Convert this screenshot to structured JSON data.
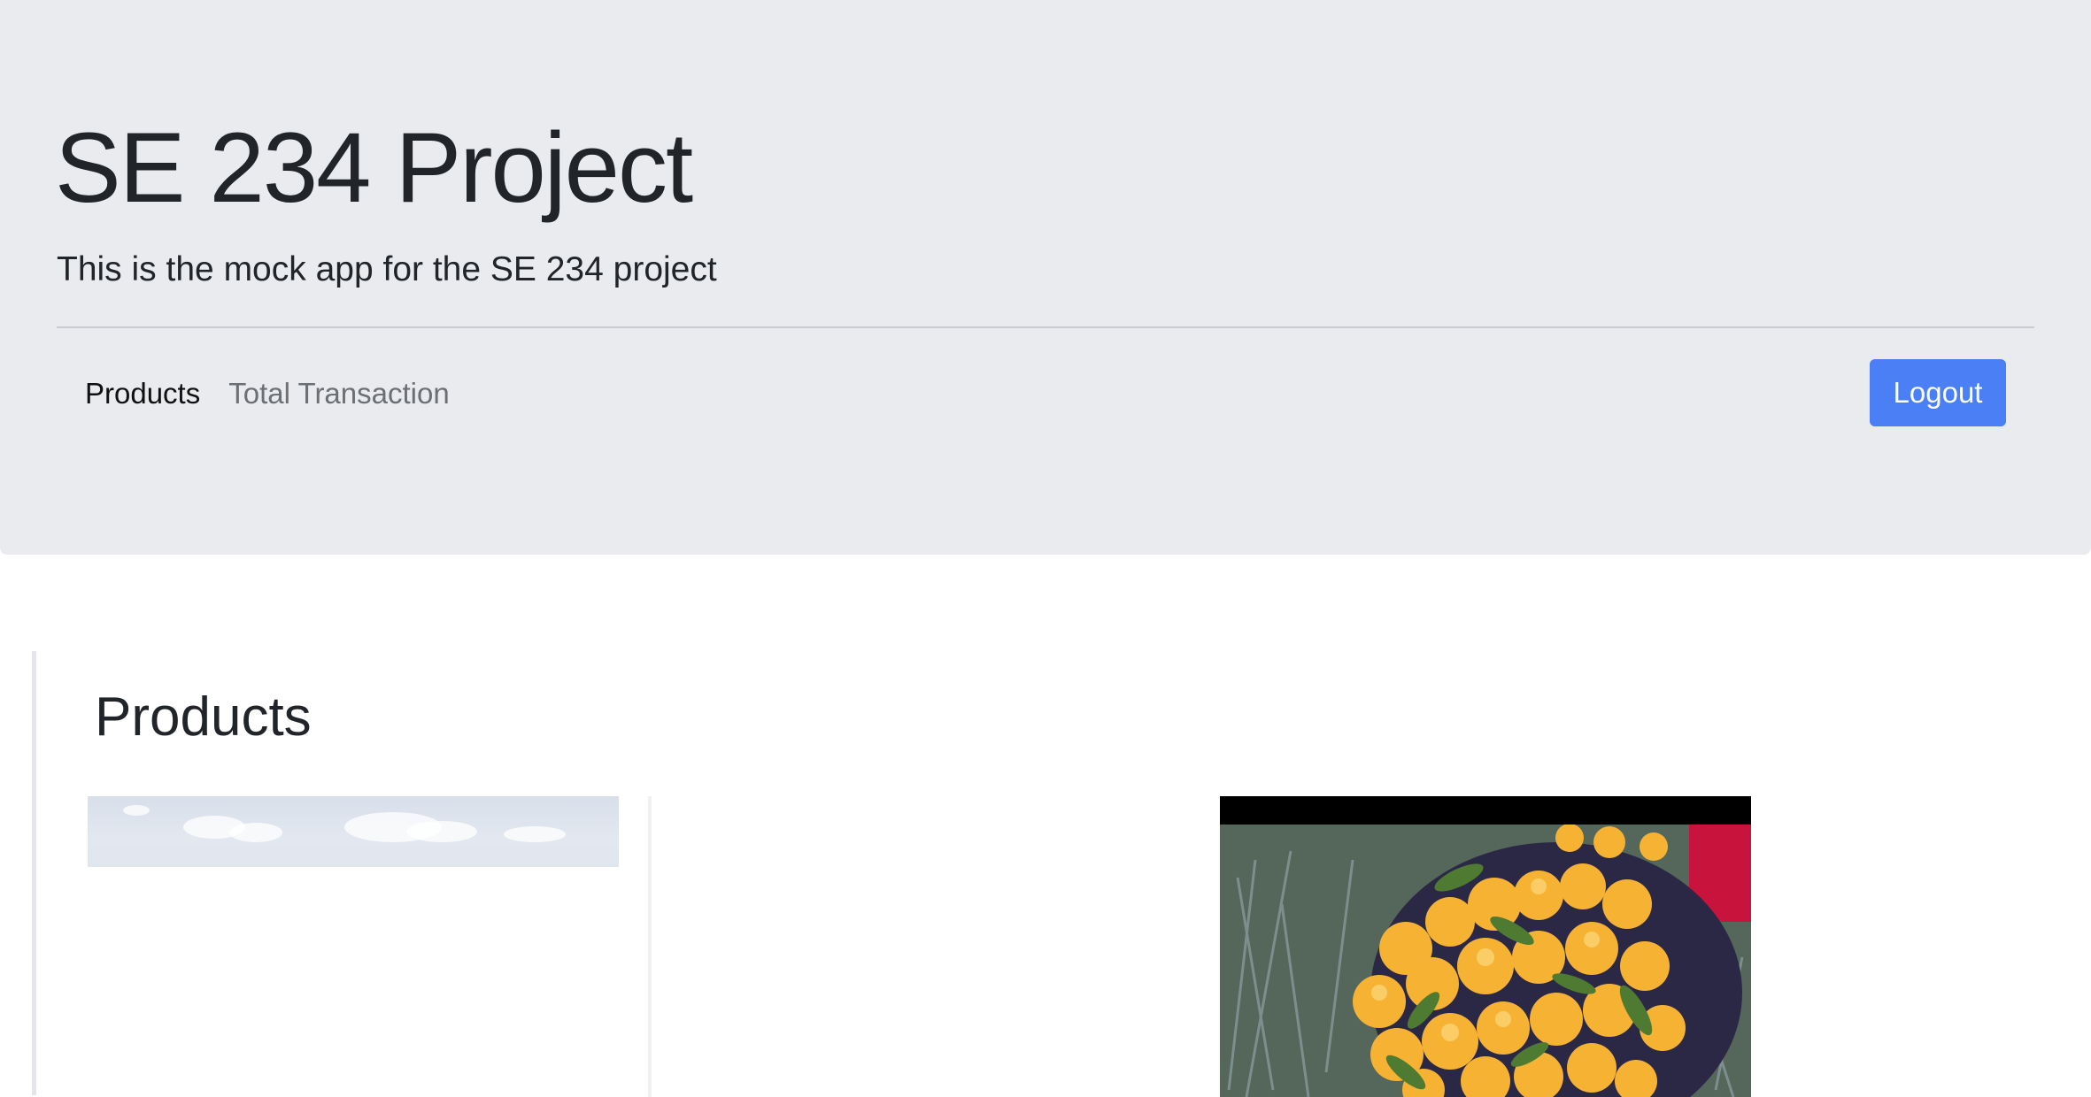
{
  "header": {
    "title": "SE 234 Project",
    "subtitle": "This is the mock app for the SE 234 project"
  },
  "nav": {
    "items": [
      {
        "label": "Products",
        "active": true
      },
      {
        "label": "Total Transaction",
        "active": false
      }
    ],
    "logout_label": "Logout"
  },
  "main": {
    "section_title": "Products"
  },
  "colors": {
    "jumbotron_bg": "#e9ebef",
    "primary_button": "#4a7ff5"
  }
}
